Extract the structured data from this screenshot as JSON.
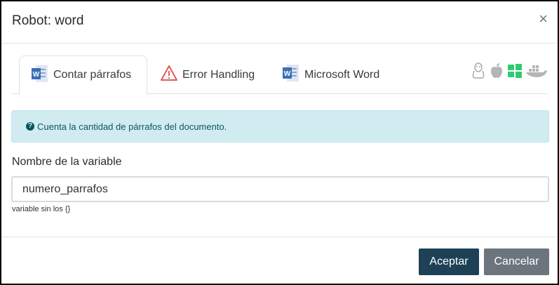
{
  "dialog": {
    "title": "Robot: word",
    "close_symbol": "×"
  },
  "tabs": [
    {
      "label": "Contar párrafos",
      "icon": "word-icon",
      "active": true
    },
    {
      "label": "Error Handling",
      "icon": "warning-icon",
      "active": false
    },
    {
      "label": "Microsoft Word",
      "icon": "word-icon",
      "active": false
    }
  ],
  "os_icons": [
    "linux-icon",
    "apple-icon",
    "windows-icon",
    "docker-icon"
  ],
  "info": {
    "icon": "question-circle-icon",
    "text": "Cuenta la cantidad de párrafos del documento."
  },
  "form": {
    "label": "Nombre de la variable",
    "value": "numero_parrafos",
    "help": "variable sin los {}"
  },
  "footer": {
    "accept_label": "Aceptar",
    "cancel_label": "Cancelar"
  },
  "colors": {
    "accent": "#1e4157",
    "secondary": "#6c757d",
    "info_bg": "#d1ecf1",
    "windows": "#2ecc71"
  }
}
